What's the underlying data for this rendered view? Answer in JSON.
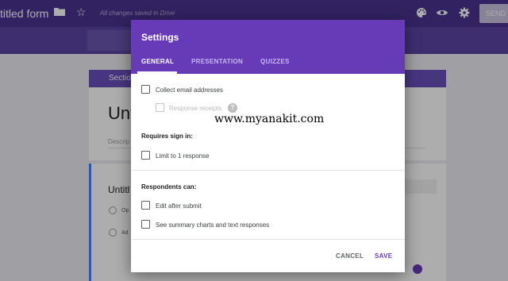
{
  "app": {
    "title": "titled form",
    "saved_status": "All changes saved in Drive",
    "send_label": "SEND",
    "icons": [
      "folder-icon",
      "star-icon",
      "palette-icon",
      "eye-icon",
      "gear-icon"
    ]
  },
  "background": {
    "section_header": "Section",
    "form_title": "Unti",
    "form_description": "Descrip",
    "question_title": "Untitl",
    "options": [
      "Op",
      "Ad"
    ]
  },
  "dialog": {
    "title": "Settings",
    "tabs": [
      {
        "label": "GENERAL",
        "active": true
      },
      {
        "label": "PRESENTATION",
        "active": false
      },
      {
        "label": "QUIZZES",
        "active": false
      }
    ],
    "collect_email": {
      "label": "Collect email addresses",
      "checked": false
    },
    "response_receipts": {
      "label": "Response receipts",
      "checked": false,
      "enabled": false,
      "help": "?"
    },
    "requires_sign_in": {
      "heading": "Requires sign in:",
      "limit_one": {
        "label": "Limit to 1 response",
        "checked": false
      }
    },
    "respondents_can": {
      "heading": "Respondents can:",
      "edit_after": {
        "label": "Edit after submit",
        "checked": false
      },
      "see_summary": {
        "label": "See summary charts and text responses",
        "checked": false
      }
    },
    "actions": {
      "cancel": "CANCEL",
      "save": "SAVE"
    }
  },
  "watermark": "www.myanakit.com",
  "colors": {
    "header": "#673ab7",
    "app_bar": "#4a3390",
    "accent_blue": "#4285f4"
  }
}
